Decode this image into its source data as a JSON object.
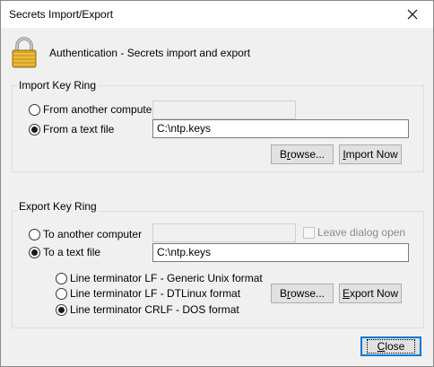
{
  "window": {
    "title": "Secrets Import/Export",
    "close_icon": "close-icon"
  },
  "header": {
    "icon": "padlock-icon",
    "text": "Authentication - Secrets import and export"
  },
  "import_group": {
    "label": "Import Key Ring",
    "options": [
      {
        "label": "From another computer",
        "selected": false
      },
      {
        "label": "From a text file",
        "selected": true
      }
    ],
    "computer_value": "",
    "file_value": "C:\\ntp.keys",
    "browse_pre": "B",
    "browse_ul": "r",
    "browse_post": "owse...",
    "import_pre": "",
    "import_ul": "I",
    "import_post": "mport Now"
  },
  "export_group": {
    "label": "Export Key Ring",
    "options": [
      {
        "label": "To another computer",
        "selected": false
      },
      {
        "label": "To a text file",
        "selected": true
      }
    ],
    "computer_value": "",
    "leave_open_label": "Leave dialog open",
    "leave_open_checked": false,
    "file_value": "C:\\ntp.keys",
    "terminators": [
      {
        "label": "Line terminator LF - Generic Unix format",
        "selected": false
      },
      {
        "label": "Line terminator LF - DTLinux format",
        "selected": false
      },
      {
        "label": "Line terminator CRLF - DOS format",
        "selected": true
      }
    ],
    "browse_pre": "B",
    "browse_ul": "r",
    "browse_post": "owse...",
    "export_pre": "",
    "export_ul": "E",
    "export_post": "xport Now"
  },
  "footer": {
    "close_pre": "",
    "close_ul": "C",
    "close_post": "lose"
  }
}
